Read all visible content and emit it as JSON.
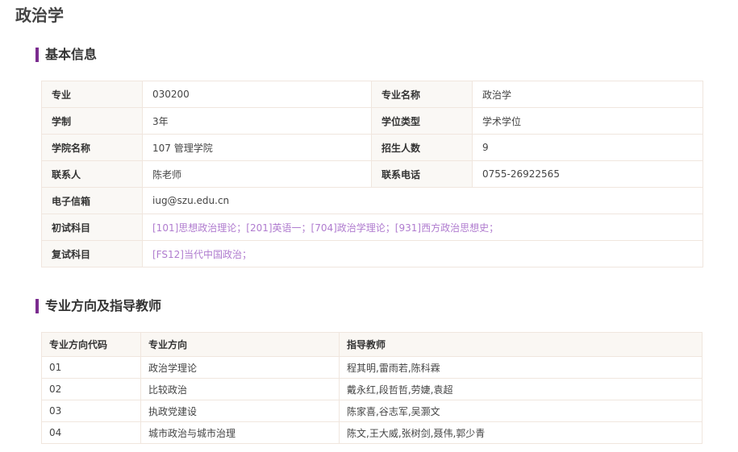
{
  "page_title": "政治学",
  "basic_info": {
    "title": "基本信息",
    "major_code_label": "专业",
    "major_code": "030200",
    "major_name_label": "专业名称",
    "major_name": "政治学",
    "duration_label": "学制",
    "duration": "3年",
    "degree_type_label": "学位类型",
    "degree_type": "学术学位",
    "college_label": "学院名称",
    "college": "107 管理学院",
    "enrollment_label": "招生人数",
    "enrollment": "9",
    "contact_label": "联系人",
    "contact": "陈老师",
    "phone_label": "联系电话",
    "phone": "0755-26922565",
    "email_label": "电子信箱",
    "email": "iug@szu.edu.cn",
    "prelim_label": "初试科目",
    "prelim": "[101]思想政治理论；[201]英语一；[704]政治学理论；[931]西方政治思想史；",
    "retest_label": "复试科目",
    "retest": "[FS12]当代中国政治；"
  },
  "directions": {
    "title": "专业方向及指导教师",
    "headers": [
      "专业方向代码",
      "专业方向",
      "指导教师"
    ],
    "rows": [
      [
        "01",
        "政治学理论",
        "程其明,雷雨若,陈科霖"
      ],
      [
        "02",
        "比较政治",
        "戴永红,段哲哲,劳婕,袁超"
      ],
      [
        "03",
        "执政党建设",
        "陈家喜,谷志军,吴灏文"
      ],
      [
        "04",
        "城市政治与城市治理",
        "陈文,王大威,张树剑,聂伟,郭少青"
      ]
    ]
  }
}
